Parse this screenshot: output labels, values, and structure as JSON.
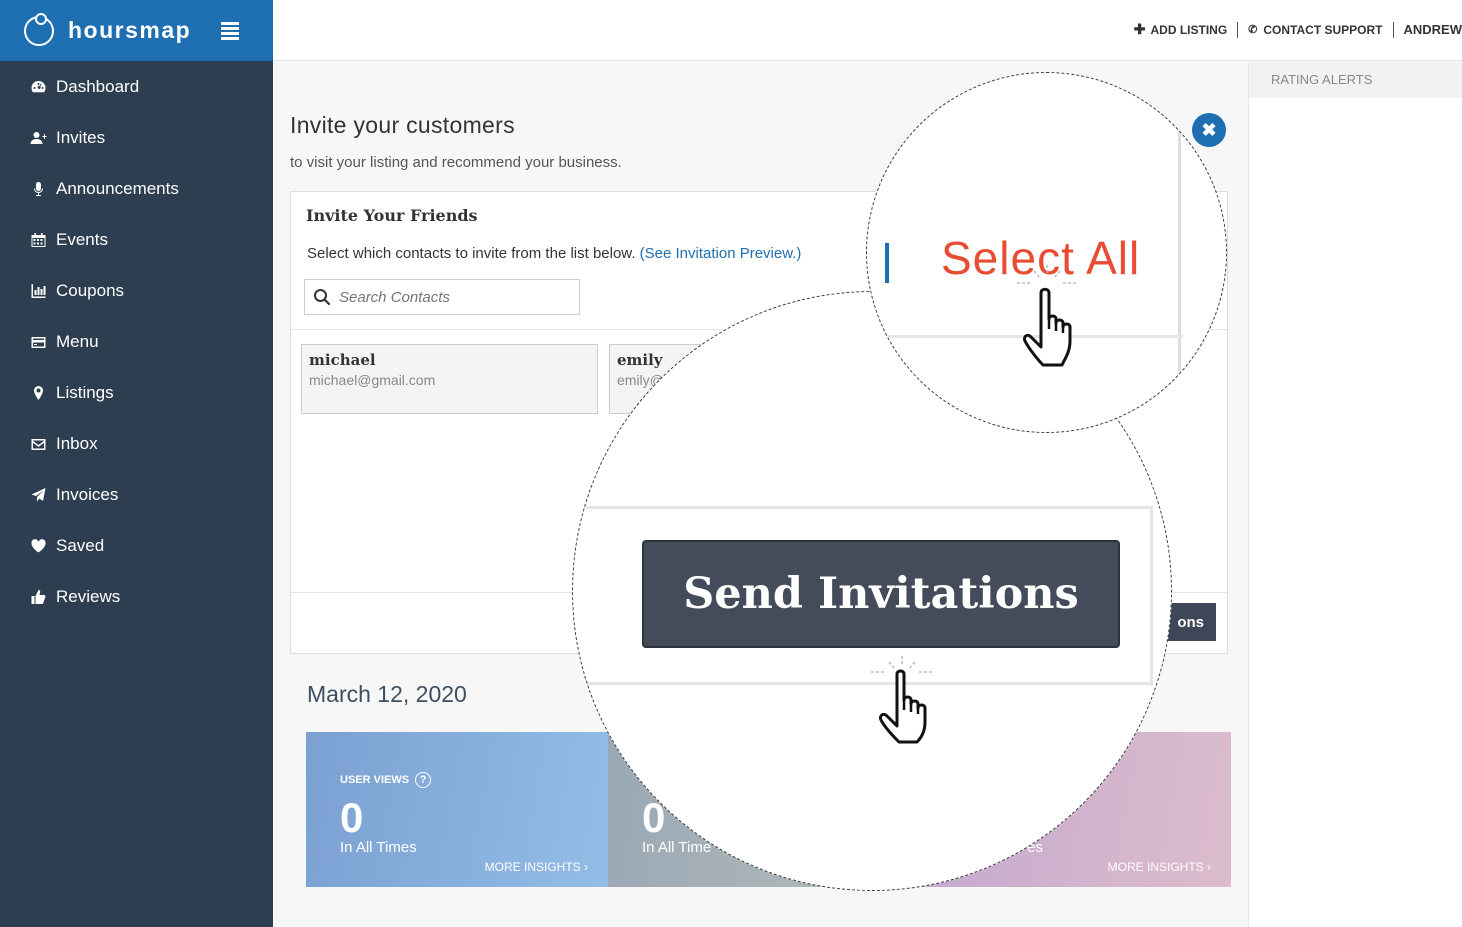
{
  "app": {
    "brand": "hoursmap"
  },
  "sidebar": {
    "items": [
      {
        "label": "Dashboard",
        "icon": "dashboard-icon"
      },
      {
        "label": "Invites",
        "icon": "user-plus-icon"
      },
      {
        "label": "Announcements",
        "icon": "microphone-icon"
      },
      {
        "label": "Events",
        "icon": "calendar-icon"
      },
      {
        "label": "Coupons",
        "icon": "bar-chart-icon"
      },
      {
        "label": "Menu",
        "icon": "credit-card-icon"
      },
      {
        "label": "Listings",
        "icon": "map-marker-icon"
      },
      {
        "label": "Inbox",
        "icon": "envelope-icon"
      },
      {
        "label": "Invoices",
        "icon": "paper-plane-icon"
      },
      {
        "label": "Saved",
        "icon": "heart-icon"
      },
      {
        "label": "Reviews",
        "icon": "thumbs-up-icon"
      }
    ]
  },
  "topbar": {
    "add_listing": "ADD LISTING",
    "contact_support": "CONTACT SUPPORT",
    "user": "ANDREW"
  },
  "right_panel": {
    "title": "RATING ALERTS"
  },
  "invite": {
    "title": "Invite your customers",
    "subtitle": "to visit your listing and recommend your business.",
    "card_title": "Invite Your Friends",
    "instruction": "Select which contacts to invite from the list below.",
    "preview_link": "(See Invitation Preview.)",
    "search_placeholder": "Search Contacts",
    "contacts": [
      {
        "name": "michael",
        "email": "michael@gmail.com"
      },
      {
        "name": "emily",
        "email": "emily@"
      }
    ],
    "send_button_partial": "ons"
  },
  "date": "March 12, 2020",
  "stats": [
    {
      "label": "USER VIEWS",
      "value": "0",
      "caption": "In All Times",
      "more": "MORE INSIGHTS ›"
    },
    {
      "value": "0",
      "caption": "In All Time"
    },
    {
      "caption": "es",
      "more": "MORE INSIGHTS ›"
    }
  ],
  "zoom": {
    "select_all": "Select All",
    "send_invitations": "Send Invitations"
  },
  "colors": {
    "sidebar": "#2d3e50",
    "brand": "#1d6fb1",
    "select_all": "#e84c32",
    "send_button": "#444b5a"
  }
}
